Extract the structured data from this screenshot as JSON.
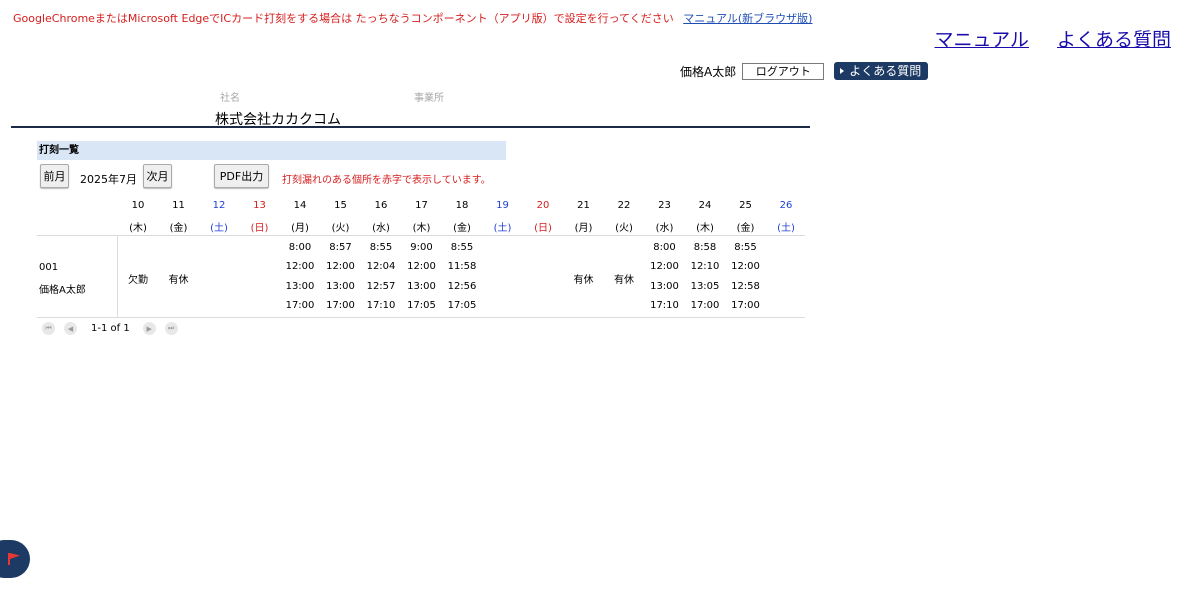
{
  "notice": {
    "text": "GoogleChromeまたはMicrosoft EdgeでICカード打刻をする場合は たっちなうコンポーネント（アプリ版）で設定を行ってください",
    "link": "マニュアル(新ブラウザ版)"
  },
  "toplinks": {
    "manual": "マニュアル",
    "faq": "よくある質問"
  },
  "user": {
    "name": "価格A太郎",
    "logout": "ログアウト",
    "faq_button": "よくある質問"
  },
  "company": {
    "label_company": "社名",
    "label_office": "事業所",
    "name": "株式会社カカクコム"
  },
  "section": {
    "title": "打刻一覧"
  },
  "controls": {
    "prev": "前月",
    "month": "2025年7月",
    "next": "次月",
    "pdf": "PDF出力",
    "info": "打刻漏れのある個所を赤字で表示しています。"
  },
  "days": [
    {
      "d": "10",
      "w": "(木)",
      "t": ""
    },
    {
      "d": "11",
      "w": "(金)",
      "t": ""
    },
    {
      "d": "12",
      "w": "(土)",
      "t": "sat"
    },
    {
      "d": "13",
      "w": "(日)",
      "t": "sun"
    },
    {
      "d": "14",
      "w": "(月)",
      "t": ""
    },
    {
      "d": "15",
      "w": "(火)",
      "t": ""
    },
    {
      "d": "16",
      "w": "(水)",
      "t": ""
    },
    {
      "d": "17",
      "w": "(木)",
      "t": ""
    },
    {
      "d": "18",
      "w": "(金)",
      "t": ""
    },
    {
      "d": "19",
      "w": "(土)",
      "t": "sat"
    },
    {
      "d": "20",
      "w": "(日)",
      "t": "sun"
    },
    {
      "d": "21",
      "w": "(月)",
      "t": ""
    },
    {
      "d": "22",
      "w": "(火)",
      "t": ""
    },
    {
      "d": "23",
      "w": "(水)",
      "t": ""
    },
    {
      "d": "24",
      "w": "(木)",
      "t": ""
    },
    {
      "d": "25",
      "w": "(金)",
      "t": ""
    },
    {
      "d": "26",
      "w": "(土)",
      "t": "sat"
    }
  ],
  "employee": {
    "id": "001",
    "name": "価格A太郎",
    "cells": [
      {
        "status": "欠勤"
      },
      {
        "status": "有休"
      },
      {},
      {},
      {
        "times": [
          "8:00",
          "12:00",
          "13:00",
          "17:00"
        ]
      },
      {
        "times": [
          "8:57",
          "12:00",
          "13:00",
          "17:00"
        ]
      },
      {
        "times": [
          "8:55",
          "12:04",
          "12:57",
          "17:10"
        ]
      },
      {
        "times": [
          "9:00",
          "12:00",
          "13:00",
          "17:05"
        ]
      },
      {
        "times": [
          "8:55",
          "11:58",
          "12:56",
          "17:05"
        ]
      },
      {},
      {},
      {
        "status": "有休"
      },
      {
        "status": "有休"
      },
      {
        "times": [
          "8:00",
          "12:00",
          "13:00",
          "17:10"
        ]
      },
      {
        "times": [
          "8:58",
          "12:10",
          "13:05",
          "17:00"
        ]
      },
      {
        "times": [
          "8:55",
          "12:00",
          "12:58",
          "17:00"
        ]
      },
      {}
    ]
  },
  "pager": {
    "text": "1-1 of 1"
  },
  "icons": {
    "pager_first": "first-page-icon",
    "pager_prev": "prev-page-icon",
    "pager_next": "next-page-icon",
    "pager_last": "last-page-icon",
    "flag": "flag-icon"
  },
  "colors": {
    "alert_red": "#d61e1e",
    "saturday_blue": "#1f3fd6",
    "navy": "#1c3a63",
    "section_bg": "#d8e6f6"
  }
}
